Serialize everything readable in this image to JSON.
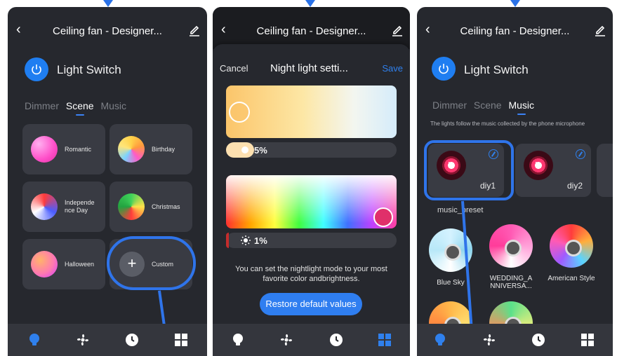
{
  "header": {
    "title": "Ceiling fan - Designer...",
    "back_icon": "chevron-left-icon",
    "edit_icon": "pencil-icon"
  },
  "switch": {
    "label": "Light Switch",
    "icon": "power-icon",
    "color": "#1f7ef1"
  },
  "tabs": {
    "dimmer": "Dimmer",
    "scene": "Scene",
    "music": "Music"
  },
  "scenes": [
    {
      "label": "Romantic",
      "color": "#ff5ac8"
    },
    {
      "label": "Birthday",
      "color": "#ffd24a"
    },
    {
      "label": "Independe nce Day",
      "color": "#ff3b3b"
    },
    {
      "label": "Christmas",
      "color": "#3fd15a"
    },
    {
      "label": "Halloween",
      "color": "#ff7ab0"
    }
  ],
  "custom": {
    "label": "Custom",
    "icon": "plus-icon"
  },
  "night_light": {
    "cancel": "Cancel",
    "title": "Night light setti...",
    "save": "Save",
    "white_brightness": "5%",
    "color_brightness": "1%",
    "hint": "You can set the nightlight mode to your most favorite color andbrightness.",
    "restore": "Restore default values"
  },
  "music": {
    "description": "The lights follow the music collected by the phone microphone",
    "diy": [
      {
        "label": "diy1"
      },
      {
        "label": "diy2"
      }
    ],
    "preset_label": "music_preset",
    "presets": [
      {
        "label": "Blue Sky"
      },
      {
        "label": "WEDDING_A NNIVERSA..."
      },
      {
        "label": "American Style"
      }
    ]
  },
  "bottom_nav": [
    "bulb-icon",
    "fan-icon",
    "clock-icon",
    "grid-icon"
  ],
  "colors": {
    "accent": "#2f74ea",
    "background": "#26282e",
    "card": "#393b43"
  }
}
